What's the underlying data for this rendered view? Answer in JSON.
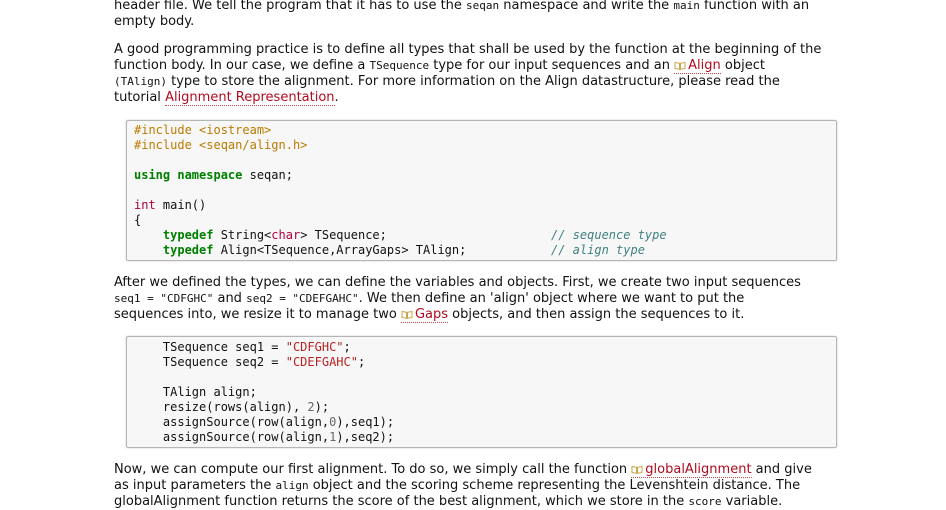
{
  "p0": {
    "l1": "header file. We tell the program that it has to use the ",
    "c1": "seqan",
    "l2": " namespace and write the ",
    "c2": "main",
    "l3": " function with an",
    "l4": "empty body."
  },
  "p1": {
    "t1": "A good programming practice is to define all types that shall be used by the function at the beginning of the",
    "t2": "function body. In our case, we define a ",
    "c1": "TSequence",
    "t3": " type for our input sequences and an ",
    "link1": "Align",
    "t4": " object",
    "c2": "(TAlign)",
    "t5": " type to store the alignment. For more information on the Align datastructure, please read the",
    "t6": "tutorial ",
    "link2": "Alignment Representation",
    "t7": "."
  },
  "code1": {
    "inc1_kw": "#include",
    "inc1_file": "<iostream>",
    "inc2_kw": "#include",
    "inc2_file": "<seqan/align.h>",
    "using_kw": "using namespace",
    "using_name": " seqan;",
    "int_kw": "int",
    "main_sig": " main()",
    "brace": "{",
    "indent": "    ",
    "typedef1_kw": "typedef",
    "typedef1_a": " String<",
    "typedef1_char": "char",
    "typedef1_b": "> TSequence;",
    "typedef1_comment": "// sequence type",
    "typedef2_kw": "typedef",
    "typedef2_a": " Align<TSequence,ArrayGaps> TAlign;",
    "typedef2_comment": "// align type"
  },
  "p2": {
    "t1": "After we defined the types, we can define the variables and objects. First, we create two input sequences",
    "c1": "seq1 = \"CDFGHC\"",
    "t2": " and ",
    "c2": "seq2 = \"CDEFGAHC\"",
    "t3": ". We then define an 'align' object where we want to put the",
    "t4": "sequences into, we resize it to manage two ",
    "link1": "Gaps",
    "t5": " objects, and then assign the sequences to it."
  },
  "code2": {
    "indent": "    ",
    "seq1_a": "TSequence seq1 = ",
    "seq1_str": "\"CDFGHC\"",
    "semi": ";",
    "seq2_a": "TSequence seq2 = ",
    "seq2_str": "\"CDEFGAHC\"",
    "align_decl": "TAlign align;",
    "resize_a": "resize(rows(align), ",
    "resize_num": "2",
    "resize_b": ");",
    "assign1_a": "assignSource(row(align,",
    "assign1_num": "0",
    "assign1_b": "),seq1);",
    "assign2_a": "assignSource(row(align,",
    "assign2_num": "1",
    "assign2_b": "),seq2);"
  },
  "p3": {
    "t1": "Now, we can compute our first alignment. To do so, we simply call the function ",
    "link1": "globalAlignment",
    "t2": " and give",
    "t3": "as input parameters the ",
    "c1": "align",
    "t4": " object and the scoring scheme representing the Levenshtein distance. The",
    "t5": "globalAlignment function returns the score of the best alignment, which we store in the ",
    "c2": "score",
    "t6": " variable."
  },
  "colors": {
    "link": "#b00b1e",
    "keyword": "#008000",
    "preprocessor": "#bc7a00",
    "string": "#ba2121",
    "comment": "#408080"
  },
  "icons": {
    "doc_link": "book-icon"
  }
}
